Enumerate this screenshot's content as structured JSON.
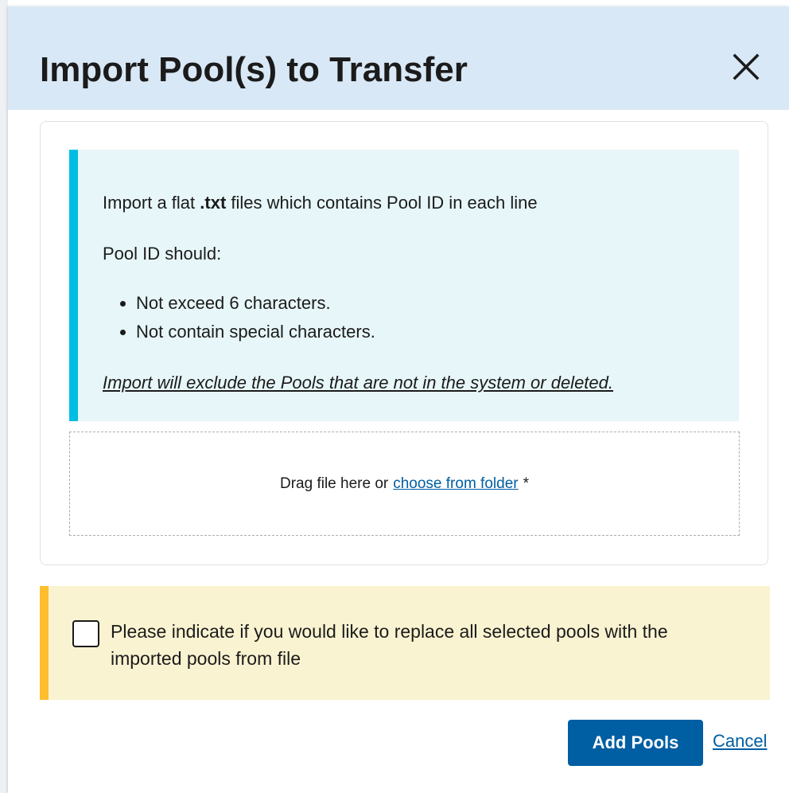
{
  "dialog": {
    "title": "Import Pool(s) to Transfer",
    "close_icon": "close-icon"
  },
  "info": {
    "intro_before": "Import a flat",
    "intro_bold": ".txt",
    "intro_after": "files which contains Pool ID in each line",
    "rules_heading": "Pool ID should:",
    "rules": [
      "Not exceed 6 characters.",
      "Not contain special characters."
    ],
    "note": "Import will exclude the Pools that are not in the system or deleted."
  },
  "dropzone": {
    "text": "Drag file here or",
    "link": "choose from folder",
    "required_marker": "*"
  },
  "replace_option": {
    "checked": false,
    "label": "Please indicate if you would like to replace all selected pools with the imported pools from file"
  },
  "actions": {
    "add_label": "Add Pools",
    "cancel_label": "Cancel"
  },
  "colors": {
    "header_bg": "#d9e8f6",
    "info_bg": "#e7f6f8",
    "info_accent": "#00bde3",
    "warning_bg": "#faf3d1",
    "warning_accent": "#ffbe2e",
    "primary": "#005ea2"
  }
}
